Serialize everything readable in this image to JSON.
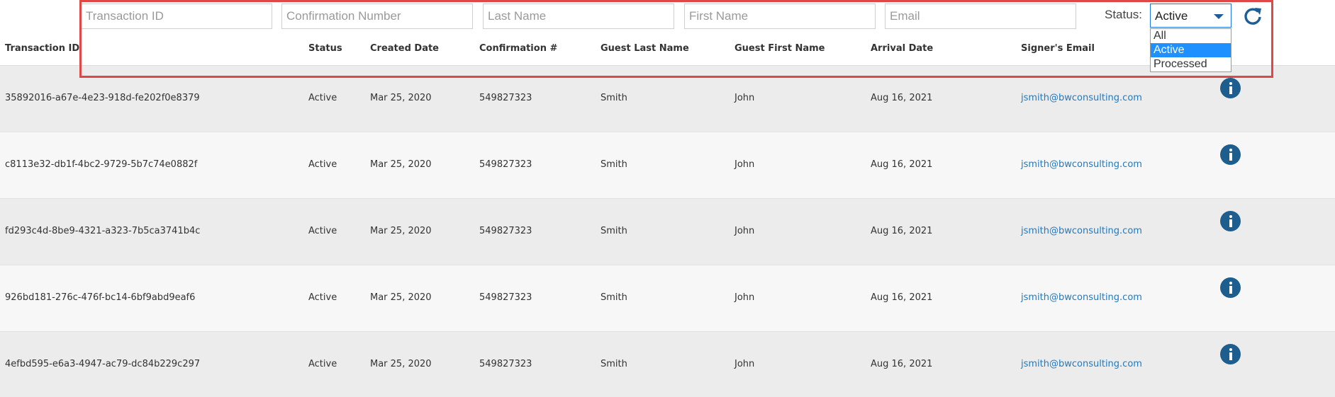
{
  "filters": {
    "transaction_id_placeholder": "Transaction ID",
    "confirmation_placeholder": "Confirmation Number",
    "last_name_placeholder": "Last Name",
    "first_name_placeholder": "First Name",
    "email_placeholder": "Email",
    "status_label": "Status:",
    "status_value": "Active",
    "status_options": [
      "All",
      "Active",
      "Processed"
    ],
    "refresh_icon": "refresh-icon"
  },
  "table": {
    "columns": [
      "Transaction ID",
      "Status",
      "Created Date",
      "Confirmation #",
      "Guest Last Name",
      "Guest First Name",
      "Arrival Date",
      "Signer's Email"
    ],
    "rows": [
      {
        "transaction_id": "35892016-a67e-4e23-918d-fe202f0e8379",
        "status": "Active",
        "created": "Mar 25, 2020",
        "confirmation": "549827323",
        "last_name": "Smith",
        "first_name": "John",
        "arrival": "Aug 16, 2021",
        "email": "jsmith@bwconsulting.com"
      },
      {
        "transaction_id": "c8113e32-db1f-4bc2-9729-5b7c74e0882f",
        "status": "Active",
        "created": "Mar 25, 2020",
        "confirmation": "549827323",
        "last_name": "Smith",
        "first_name": "John",
        "arrival": "Aug 16, 2021",
        "email": "jsmith@bwconsulting.com"
      },
      {
        "transaction_id": "fd293c4d-8be9-4321-a323-7b5ca3741b4c",
        "status": "Active",
        "created": "Mar 25, 2020",
        "confirmation": "549827323",
        "last_name": "Smith",
        "first_name": "John",
        "arrival": "Aug 16, 2021",
        "email": "jsmith@bwconsulting.com"
      },
      {
        "transaction_id": "926bd181-276c-476f-bc14-6bf9abd9eaf6",
        "status": "Active",
        "created": "Mar 25, 2020",
        "confirmation": "549827323",
        "last_name": "Smith",
        "first_name": "John",
        "arrival": "Aug 16, 2021",
        "email": "jsmith@bwconsulting.com"
      },
      {
        "transaction_id": "4efbd595-e6a3-4947-ac79-dc84b229c297",
        "status": "Active",
        "created": "Mar 25, 2020",
        "confirmation": "549827323",
        "last_name": "Smith",
        "first_name": "John",
        "arrival": "Aug 16, 2021",
        "email": "jsmith@bwconsulting.com"
      }
    ]
  },
  "colors": {
    "accent": "#1f7ac2",
    "info_icon": "#1d5e8f",
    "highlight": "#e04848",
    "selected_option": "#1e90ff"
  }
}
